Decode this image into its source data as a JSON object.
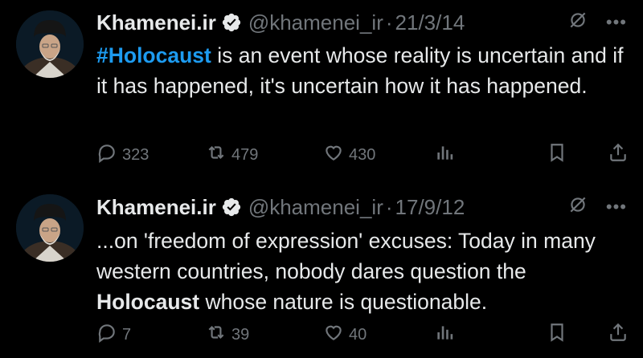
{
  "tweets": [
    {
      "author": {
        "name": "Khamenei.ir",
        "handle": "@khamenei_ir",
        "separator": "·"
      },
      "date": "21/3/14",
      "text": {
        "hashtag": "#Holocaust",
        "rest": " is an event whose reality is uncertain and if it has happened, it's uncertain how it has happened."
      },
      "actions": {
        "replies": "323",
        "reposts": "479",
        "likes": "430"
      }
    },
    {
      "author": {
        "name": "Khamenei.ir",
        "handle": "@khamenei_ir",
        "separator": "·"
      },
      "date": "17/9/12",
      "text": {
        "before": "...on 'freedom of expression' excuses: Today in many western countries, nobody dares question the ",
        "bold": "Holocaust",
        "after": " whose nature is questionable."
      },
      "actions": {
        "replies": "7",
        "reposts": "39",
        "likes": "40"
      }
    }
  ],
  "icons": {
    "verified": "verified-badge-icon",
    "grok": "grok-icon",
    "more": "more-icon",
    "reply": "reply-icon",
    "repost": "repost-icon",
    "like": "like-icon",
    "views": "views-icon",
    "bookmark": "bookmark-icon",
    "share": "share-icon"
  },
  "colors": {
    "background": "#000000",
    "text": "#e7e9ea",
    "muted": "#71767b",
    "accent": "#1d9bf0"
  }
}
